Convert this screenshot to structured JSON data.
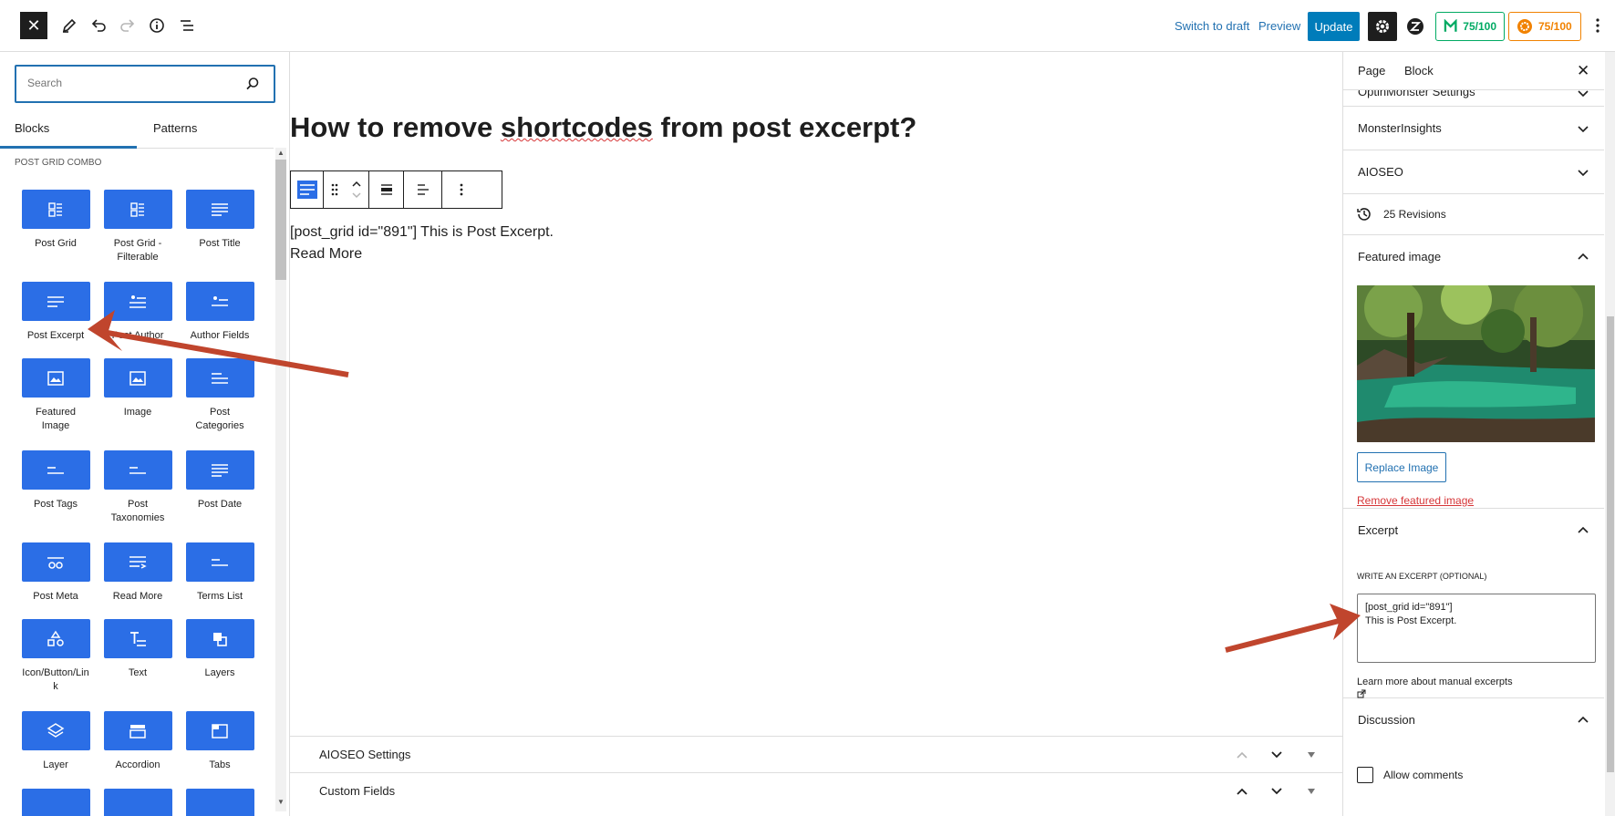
{
  "topbar": {
    "close_icon": "close-icon",
    "switch_draft": "Switch to draft",
    "preview": "Preview",
    "update": "Update",
    "score_green": "75/100",
    "score_orange": "75/100"
  },
  "inserter": {
    "search_placeholder": "Search",
    "tabs": [
      "Blocks",
      "Patterns"
    ],
    "category": "POST GRID COMBO",
    "blocks": [
      {
        "label": "Post Grid",
        "icon": "grid-icon"
      },
      {
        "label": "Post Grid - Filterable",
        "icon": "grid-icon"
      },
      {
        "label": "Post Title",
        "icon": "lines-icon"
      },
      {
        "label": "Post Excerpt",
        "icon": "lines-icon"
      },
      {
        "label": "Post Author",
        "icon": "author-icon"
      },
      {
        "label": "Author Fields",
        "icon": "author-fields-icon"
      },
      {
        "label": "Featured Image",
        "icon": "image-icon"
      },
      {
        "label": "Image",
        "icon": "image-icon"
      },
      {
        "label": "Post Categories",
        "icon": "align-left-icon"
      },
      {
        "label": "Post Tags",
        "icon": "align-left-icon"
      },
      {
        "label": "Post Taxonomies",
        "icon": "align-left-icon"
      },
      {
        "label": "Post Date",
        "icon": "lines-icon"
      },
      {
        "label": "Post Meta",
        "icon": "meta-icon"
      },
      {
        "label": "Read More",
        "icon": "read-more-icon"
      },
      {
        "label": "Terms List",
        "icon": "align-left-icon"
      },
      {
        "label": "Icon/Button/Link",
        "icon": "shapes-icon"
      },
      {
        "label": "Text",
        "icon": "text-icon"
      },
      {
        "label": "Layers",
        "icon": "layers-icon"
      },
      {
        "label": "Layer",
        "icon": "layer-icon"
      },
      {
        "label": "Accordion",
        "icon": "accordion-icon"
      },
      {
        "label": "Tabs",
        "icon": "tabs-icon"
      }
    ]
  },
  "canvas": {
    "title_before": "How to remove ",
    "title_misspelled": "shortcodes",
    "title_after": " from post excerpt?",
    "excerpt_line": "[post_grid id=\"891\"] This is Post Excerpt.",
    "read_more": "Read More",
    "metaboxes": [
      "AIOSEO Settings",
      "Custom Fields"
    ]
  },
  "sidebar": {
    "tabs": [
      "Page",
      "Block"
    ],
    "panels": {
      "optinmonster": "OptinMonster Settings",
      "monsterinsights": "MonsterInsights",
      "aioseo": "AIOSEO",
      "revisions": "25 Revisions",
      "featured_image": "Featured image",
      "excerpt": "Excerpt",
      "discussion": "Discussion"
    },
    "replace_image": "Replace Image",
    "remove_image": "Remove featured image",
    "excerpt_label": "WRITE AN EXCERPT (OPTIONAL)",
    "excerpt_value": "[post_grid id=\"891\"]\nThis is Post Excerpt.",
    "learn_more": "Learn more about manual excerpts",
    "allow_comments": "Allow comments"
  },
  "colors": {
    "accent": "#2271b1",
    "block_blue": "#2b6ee6",
    "arrow": "#c0452d",
    "score_green": "#00aa63",
    "score_orange": "#f18200"
  }
}
